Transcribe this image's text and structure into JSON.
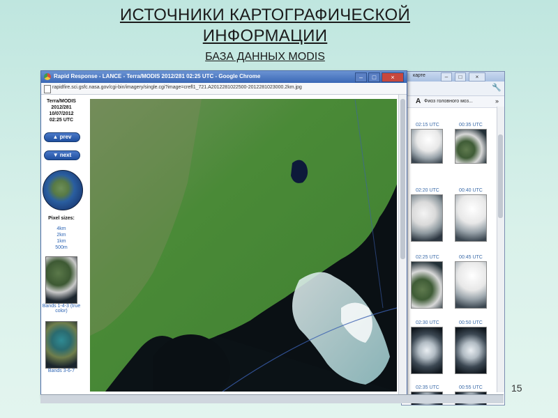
{
  "slide": {
    "title_line1": "ИСТОЧНИКИ КАРТОГРАФИЧЕСКОЙ",
    "title_line2": "ИНФОРМАЦИИ",
    "subtitle": "БАЗА ДАННЫХ MODIS",
    "page_number": "15"
  },
  "foreground_window": {
    "title": "Rapid Response - LANCE - Terra/MODIS 2012/281 02:25 UTC - Google Chrome",
    "url": "rapidfire.sci.gsfc.nasa.gov/cgi-bin/imagery/single.cgi?image=crefl1_721.A2012281022500-2012281023000.2km.jpg",
    "controls": {
      "minimize": "–",
      "maximize": "□",
      "close": "×"
    },
    "info": {
      "line1": "Terra/MODIS",
      "line2": "2012/281",
      "line3": "10/07/2012",
      "line4": "02:25 UTC"
    },
    "prev_label": "▲ prev",
    "next_label": "▼ next",
    "pixel_sizes_title": "Pixel sizes:",
    "pixel_sizes": [
      "4km",
      "2km",
      "1km",
      "500m"
    ],
    "band_captions": [
      "Bands 1-4-3 (true color)",
      "Bands 3-6-7"
    ]
  },
  "background_window": {
    "tab_text": "карте",
    "bookmark_text": "Фиоз головного моз...",
    "controls": {
      "minimize": "–",
      "maximize": "□",
      "close": "×"
    },
    "thumbnails": [
      {
        "left_time": "02:15 UTC",
        "right_time": "00:35 UTC"
      },
      {
        "left_time": "02:20 UTC",
        "right_time": "00:40 UTC"
      },
      {
        "left_time": "02:25 UTC",
        "right_time": "00:45 UTC"
      },
      {
        "left_time": "02:30 UTC",
        "right_time": "00:50 UTC"
      },
      {
        "left_time": "02:35 UTC",
        "right_time": "00:55 UTC"
      }
    ]
  },
  "colors": {
    "slide_bg": "#cdeee6",
    "land_green": "#4c8a3a",
    "sea_dark": "#0b1216",
    "link_blue": "#2b63b3",
    "button_blue": "#2c5fb0"
  }
}
